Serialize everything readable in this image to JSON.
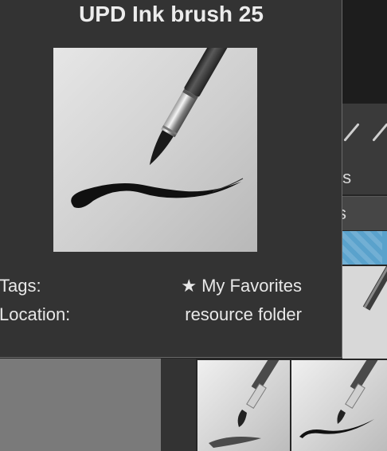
{
  "popup": {
    "title": "UPD Ink brush 25",
    "tags_label": "Tags:",
    "tags_star": "★",
    "tags_value": "My Favorites",
    "location_label": "Location:",
    "location_value": "resource folder"
  },
  "background": {
    "label_1": "ts",
    "label_2": "s"
  }
}
